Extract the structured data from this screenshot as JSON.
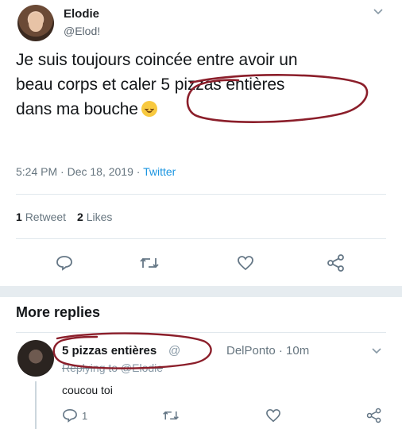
{
  "tweet": {
    "author_name": "Elodie",
    "author_handle": "@Elod!",
    "text_line1": "Je suis toujours coincée entre avoir un",
    "text_line2": "beau corps et caler 5 pizzas entières",
    "text_line3": "dans ma bouche",
    "time_date": "5:24 PM · Dec 18, 2019 · ",
    "source": "Twitter",
    "retweets_count": "1",
    "retweets_label": "Retweet",
    "likes_count": "2",
    "likes_label": "Likes"
  },
  "replies_section": {
    "title": "More replies"
  },
  "reply": {
    "author_name": "5 pizzas entières",
    "author_handle": "@",
    "meta": "DelPonto · 10m",
    "replying_to": "Replying to @Elodie",
    "text": "coucou toi",
    "reply_count": "1"
  },
  "colors": {
    "annotation_red": "#8b1e2a",
    "link_blue": "#1b95e0",
    "icon_grey": "#657786",
    "divider": "#e1e8ed"
  },
  "icons": {
    "reply": "speech-bubble-icon",
    "retweet": "retweet-icon",
    "like": "heart-icon",
    "share": "share-icon",
    "menu": "chevron-down-icon",
    "emoji": "relieved-face-emoji"
  }
}
